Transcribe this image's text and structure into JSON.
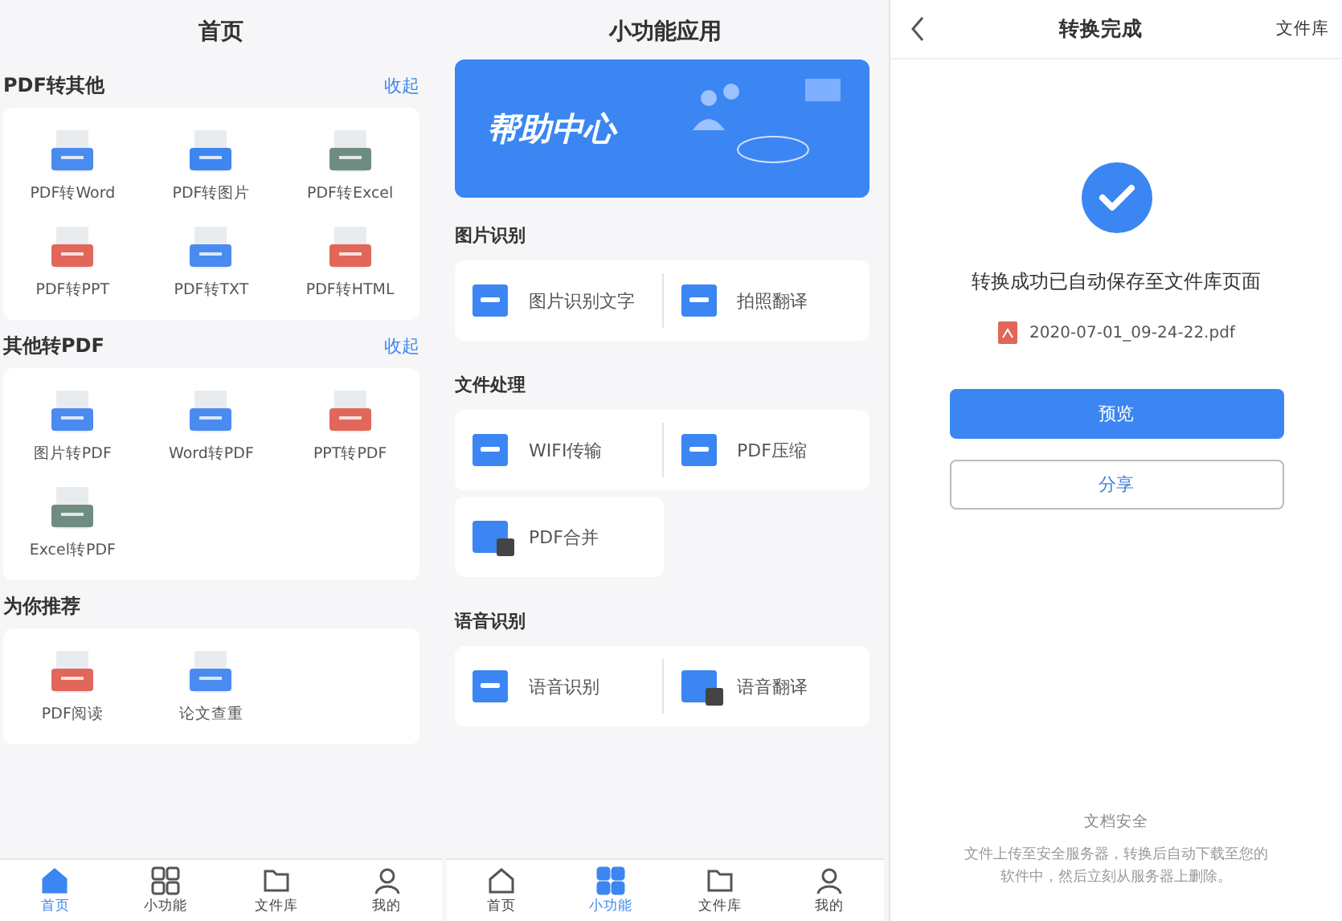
{
  "home": {
    "title": "首页",
    "sections": [
      {
        "title": "PDF转其他",
        "action": "收起",
        "items": [
          "PDF转Word",
          "PDF转图片",
          "PDF转Excel",
          "PDF转PPT",
          "PDF转TXT",
          "PDF转HTML"
        ]
      },
      {
        "title": "其他转PDF",
        "action": "收起",
        "items": [
          "图片转PDF",
          "Word转PDF",
          "PPT转PDF",
          "Excel转PDF"
        ]
      },
      {
        "title": "为你推荐",
        "items": [
          "PDF阅读",
          "论文查重"
        ]
      }
    ],
    "nav": [
      {
        "label": "首页",
        "selected": true
      },
      {
        "label": "小功能",
        "selected": false
      },
      {
        "label": "文件库",
        "selected": false
      },
      {
        "label": "我的",
        "selected": false
      }
    ]
  },
  "tools": {
    "title": "小功能应用",
    "banner": {
      "title": "帮助中心"
    },
    "groups": [
      {
        "title": "图片识别",
        "cards": [
          [
            "图片识别文字",
            "拍照翻译"
          ]
        ]
      },
      {
        "title": "文件处理",
        "cards": [
          [
            "WIFI传输",
            "PDF压缩"
          ],
          [
            "PDF合并"
          ]
        ]
      },
      {
        "title": "语音识别",
        "cards": [
          [
            "语音识别",
            "语音翻译"
          ]
        ]
      }
    ],
    "nav": [
      {
        "label": "首页",
        "selected": false
      },
      {
        "label": "小功能",
        "selected": true
      },
      {
        "label": "文件库",
        "selected": false
      },
      {
        "label": "我的",
        "selected": false
      }
    ]
  },
  "result": {
    "title": "转换完成",
    "link": "文件库",
    "message": "转换成功已自动保存至文件库页面",
    "file": "2020-07-01_09-24-22.pdf",
    "buttons": [
      {
        "label": "预览",
        "kind": "primary"
      },
      {
        "label": "分享",
        "kind": "outline"
      }
    ],
    "footer_title": "文档安全",
    "footer_text": "文件上传至安全服务器，转换后自动下载至您的软件中，然后立刻从服务器上删除。"
  }
}
